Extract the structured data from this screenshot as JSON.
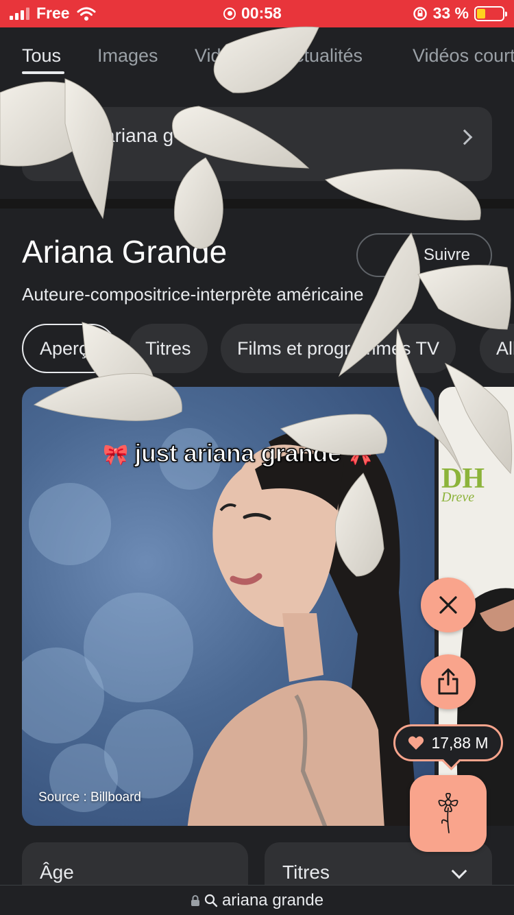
{
  "status_bar": {
    "carrier": "Free",
    "time": "00:58",
    "battery": "33 %"
  },
  "tabs": [
    {
      "label": "Tous"
    },
    {
      "label": "Images"
    },
    {
      "label": "Vidéos"
    },
    {
      "label": "Actualités"
    },
    {
      "label": "Vidéos courtes"
    }
  ],
  "search_card": {
    "query": "ariana g"
  },
  "knowledge_panel": {
    "title": "Ariana Grande",
    "subtitle": "Auteure-compositrice-interprète américaine",
    "follow_label": "Suivre",
    "chips": [
      "Aperçu",
      "Titres",
      "Films et programmes TV",
      "Albums"
    ],
    "image_source": "Source : Billboard",
    "second_image_logo": "DH",
    "second_image_logo_sub": "Dreve",
    "cards": [
      {
        "label": "Âge"
      },
      {
        "label": "Titres"
      }
    ]
  },
  "overlay": {
    "caption": "just ariana grande",
    "bow_emoji": "🎀"
  },
  "actions": {
    "likes": "17,88 M"
  },
  "url_bar": {
    "text": "ariana grande"
  },
  "colors": {
    "status_bar": "#e8353b",
    "accent": "#f9a48c",
    "background": "#202124"
  },
  "icons": [
    "wifi-icon",
    "record-icon",
    "rotation-lock-icon",
    "battery-icon",
    "chevron-right-icon",
    "close-icon",
    "share-icon",
    "heart-icon",
    "flower-icon",
    "lock-icon",
    "search-icon",
    "chevron-down-icon"
  ]
}
